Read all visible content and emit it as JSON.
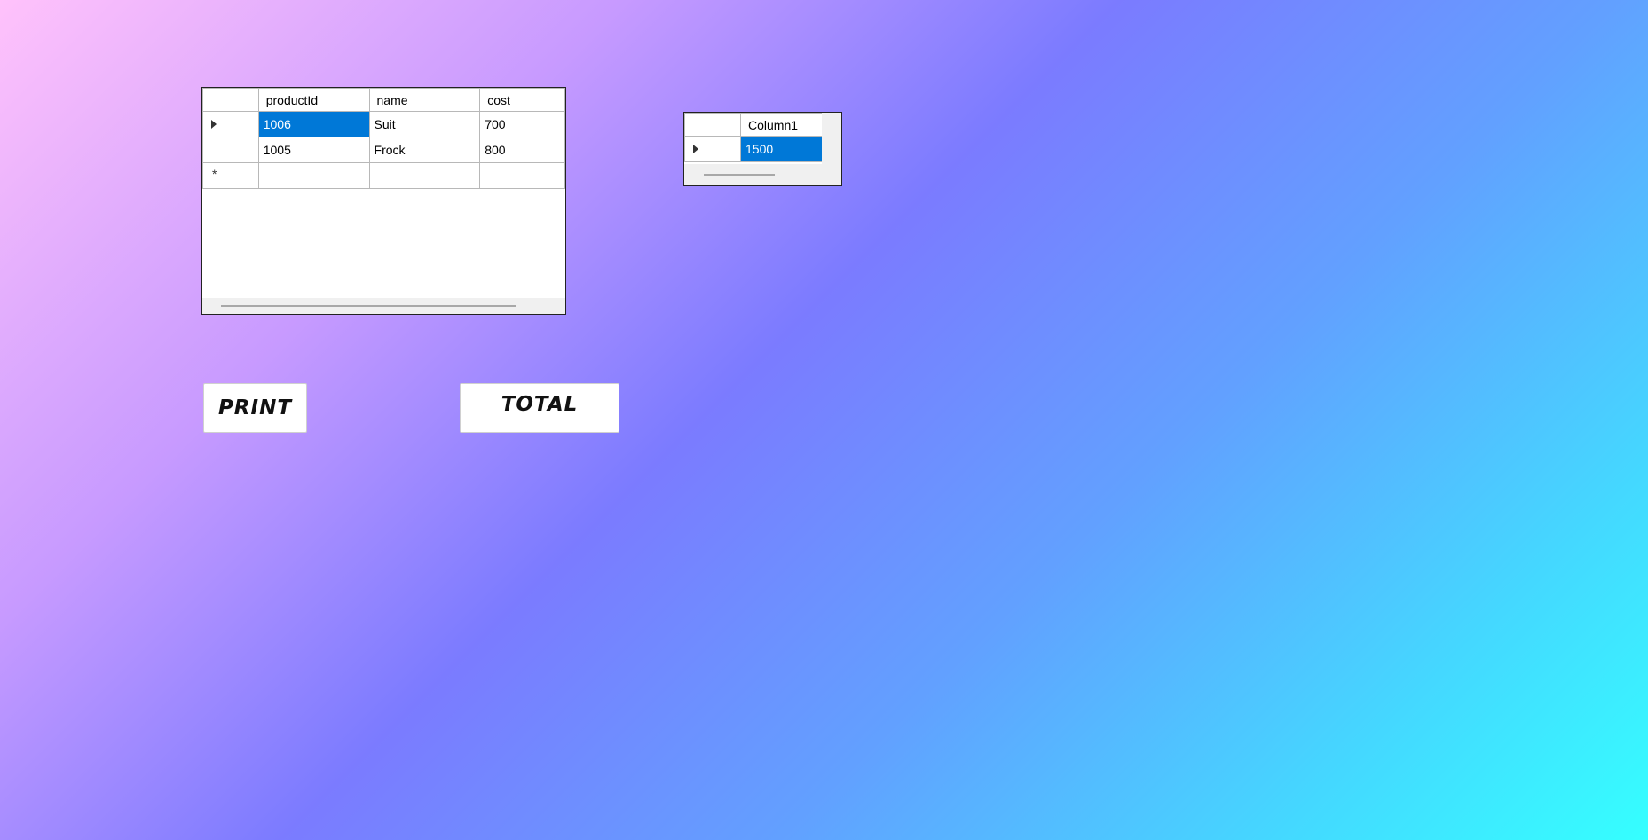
{
  "products_grid": {
    "columns": [
      "productId",
      "name",
      "cost"
    ],
    "rows": [
      {
        "productId": "1006",
        "name": "Suit",
        "cost": "700",
        "current": true,
        "selected_col": "productId"
      },
      {
        "productId": "1005",
        "name": "Frock",
        "cost": "800",
        "current": false
      }
    ],
    "new_row_marker": "*"
  },
  "total_grid": {
    "columns": [
      "Column1"
    ],
    "rows": [
      {
        "Column1": "1500",
        "current": true
      }
    ]
  },
  "buttons": {
    "print_label": "PRINT",
    "total_label": "TOTAL"
  },
  "colors": {
    "selection": "#0078d7",
    "gradient_start": "#ffc2fb",
    "gradient_mid": "#7b7bff",
    "gradient_end": "#35ffff"
  }
}
